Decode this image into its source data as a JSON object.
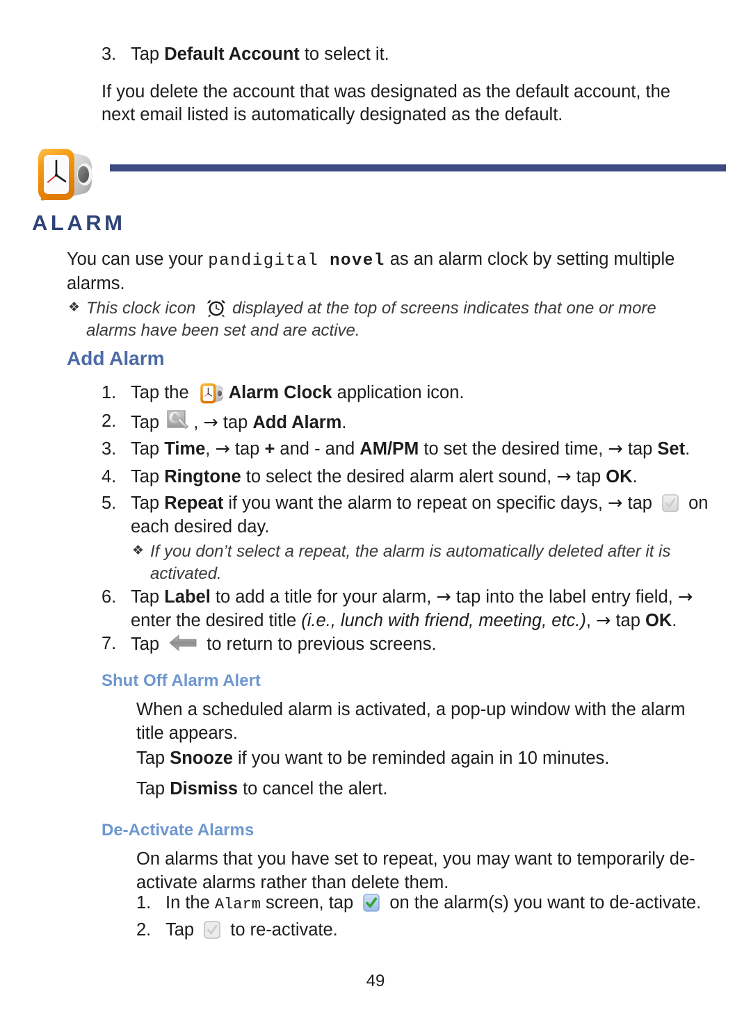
{
  "page": {
    "number": "49"
  },
  "intro": {
    "step_number": "3.",
    "step_prefix": "Tap ",
    "step_bold": "Default Account",
    "step_suffix": " to select it.",
    "paragraph": "If you delete the account that was designated as the default account, the next email listed is automatically designated as the default."
  },
  "section": {
    "title": "ALARM",
    "icon": "alarm-clock-3d-icon",
    "rule_color": "#3c4c82",
    "title_color": "#2e4377",
    "intro_prefix": "You can use your ",
    "intro_brand_regular": "pandigital",
    "intro_brand_bold": "novel",
    "intro_suffix": " as an alarm clock by setting multiple alarms.",
    "note": {
      "bullet": "❖",
      "before_icon": "This clock icon",
      "icon": "alarm-clock-glyph-icon",
      "after_icon": "displayed at the top of screens indicates that one or more alarms have been set and are active."
    }
  },
  "add_alarm": {
    "heading": "Add Alarm",
    "heading_color": "#4b6aa5",
    "steps": [
      {
        "num": "1.",
        "pre": "Tap the ",
        "icon": "alarm-clock-3d-icon",
        "bold": "Alarm Clock",
        "post": " application icon."
      },
      {
        "num": "2.",
        "pre": "Tap ",
        "icon": "wrench-settings-icon",
        "mid": ", ",
        "arrow": "→",
        "mid2": " tap ",
        "bold": "Add Alarm",
        "post": "."
      },
      {
        "num": "3.",
        "pre": "Tap ",
        "bold1": "Time",
        "mid1": ", ",
        "arrow1": "→",
        "mid2": " tap ",
        "bold2": "+",
        "mid3": " and ",
        "plain3": "-",
        "mid4": " and ",
        "bold3": "AM/PM",
        "mid5": " to set the desired time, ",
        "arrow2": "→",
        "mid6": " tap ",
        "bold4": "Set",
        "post": "."
      },
      {
        "num": "4.",
        "pre": "Tap ",
        "bold1": "Ringtone",
        "mid1": " to select the desired alarm alert sound, ",
        "arrow1": "→",
        "mid2": " tap ",
        "bold2": "OK",
        "post": "."
      },
      {
        "num": "5.",
        "pre": "Tap ",
        "bold1": "Repeat",
        "mid1": " if you want the alarm to repeat on specific days, ",
        "arrow1": "→",
        "mid2": " tap ",
        "icon": "checkbox-unchecked-icon",
        "post": " on each desired day."
      },
      {
        "num": "6.",
        "pre": "Tap ",
        "bold1": "Label",
        "mid1": " to add a title for your alarm, ",
        "arrow1": "→",
        "mid2": " tap into the label entry field, ",
        "arrow2": "→",
        "mid3": " enter the desired title ",
        "italic1": "(i.e., lunch with friend, meeting, etc.)",
        "mid4": ", ",
        "arrow3": "→",
        "mid5": " tap ",
        "bold2": "OK",
        "post": "."
      },
      {
        "num": "7.",
        "pre": "Tap ",
        "icon": "back-arrow-icon",
        "post": " to return to previous screens."
      }
    ],
    "sub_note": {
      "bullet": "❖",
      "text": "If you don’t select a repeat, the alarm is automatically deleted after it is activated."
    }
  },
  "shut_off": {
    "heading": "Shut Off Alarm Alert",
    "heading_color": "#6e97cf",
    "para1": "When a scheduled alarm is activated, a pop-up window with the alarm title appears.",
    "para2_pre": "Tap ",
    "para2_bold": "Snooze",
    "para2_post": " if you want to be reminded again in 10 minutes.",
    "para3_pre": "Tap ",
    "para3_bold": "Dismiss",
    "para3_post": " to cancel the alert."
  },
  "de_activate": {
    "heading": "De-Activate Alarms",
    "heading_color": "#6e97cf",
    "para1": "On alarms that you have set to repeat, you may want to temporarily de-activate alarms rather than delete them.",
    "steps": [
      {
        "num": "1.",
        "pre": "In the ",
        "mono": "Alarm",
        "mid": " screen, tap ",
        "icon": "checkbox-checked-green-icon",
        "post": " on the alarm(s) you want to de-activate."
      },
      {
        "num": "2.",
        "pre": "Tap ",
        "icon": "checkbox-unchecked-icon",
        "post": " to re-activate."
      }
    ]
  },
  "colors": {
    "accent_navy": "#2e4377",
    "accent_blue": "#4b6aa5",
    "accent_light_blue": "#6e97cf",
    "checkbox_green": "#2fa82f",
    "checkbox_blue_bg": "#a9c6ef",
    "clock_orange": "#f09a12"
  }
}
